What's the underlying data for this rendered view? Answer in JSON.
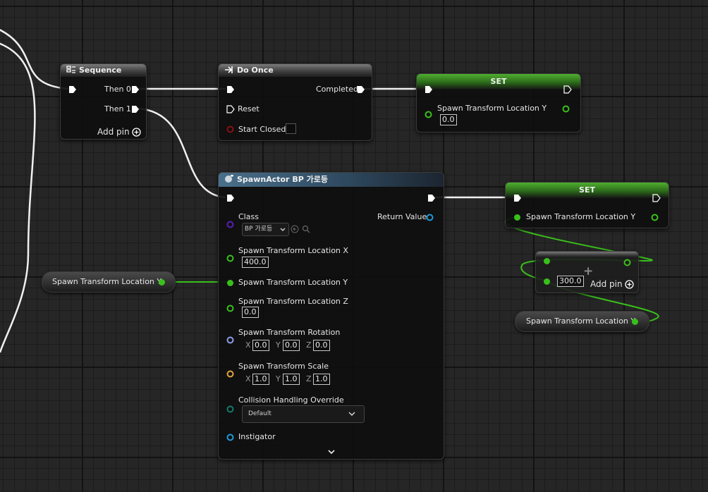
{
  "sequence": {
    "title": "Sequence",
    "then0": "Then 0",
    "then1": "Then 1",
    "add_pin": "Add pin"
  },
  "do_once": {
    "title": "Do Once",
    "completed": "Completed",
    "reset": "Reset",
    "start_closed": "Start Closed"
  },
  "set1": {
    "title": "SET",
    "var_label": "Spawn Transform Location Y",
    "value": "0.0"
  },
  "set2": {
    "title": "SET",
    "var_label": "Spawn Transform Location Y"
  },
  "spawn": {
    "title": "SpawnActor BP 가로등",
    "class_label": "Class",
    "class_value": "BP 가로등",
    "return_value": "Return Value",
    "loc_x_label": "Spawn Transform Location X",
    "loc_x_value": "400.0",
    "loc_y_label": "Spawn Transform Location Y",
    "loc_z_label": "Spawn Transform Location Z",
    "loc_z_value": "0.0",
    "rotation_label": "Spawn Transform Rotation",
    "rotation": {
      "x": "0.0",
      "y": "0.0",
      "z": "0.0"
    },
    "scale_label": "Spawn Transform Scale",
    "scale": {
      "x": "1.0",
      "y": "1.0",
      "z": "1.0"
    },
    "collision_label": "Collision Handling Override",
    "collision_value": "Default",
    "instigator_label": "Instigator"
  },
  "axis": {
    "x": "X",
    "y": "Y",
    "z": "Z"
  },
  "get_var_left": {
    "label": "Spawn Transform Location Y"
  },
  "get_var_right": {
    "label": "Spawn Transform Location Y"
  },
  "add_node": {
    "value": "300.0",
    "add_pin": "Add pin",
    "symbol": "+"
  },
  "colors": {
    "exec": "#ffffff",
    "float": "#39c01b",
    "class": "#5a1fb4",
    "object": "#1f9ad8",
    "struct_rot": "#8f9ee8",
    "struct_scale": "#e0a53b",
    "byte": "#157a6a",
    "bool": "#8b1010"
  }
}
